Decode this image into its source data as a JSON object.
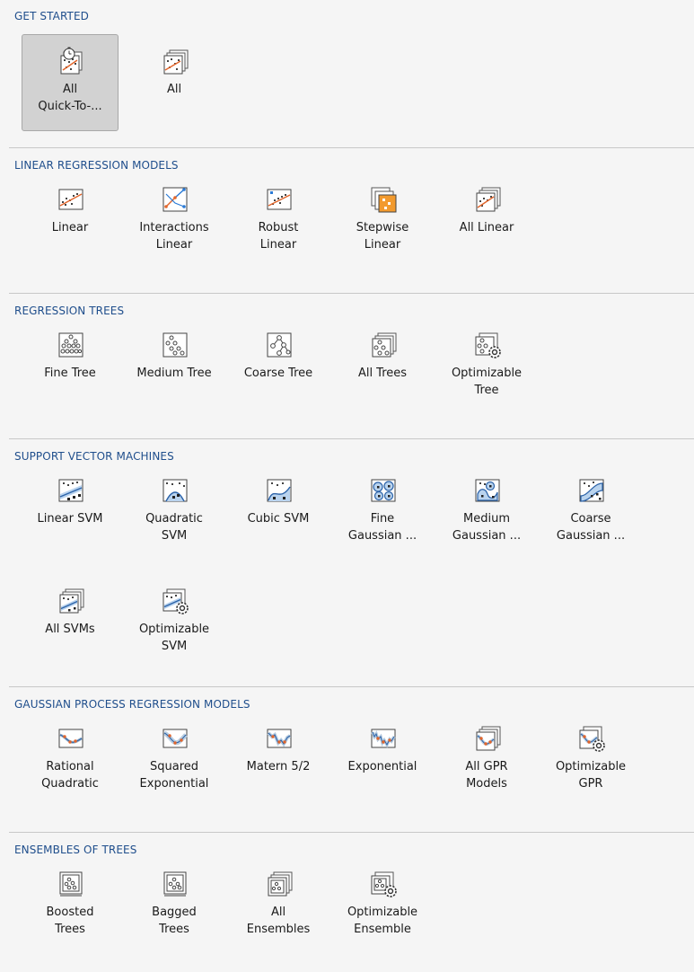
{
  "sections": {
    "get_started": {
      "title": "GET STARTED",
      "items": [
        {
          "label": "All\nQuick-To-...",
          "icon": "stopwatch-scatter-icon",
          "selected": true
        },
        {
          "label": "All",
          "icon": "stacked-scatter-icon"
        }
      ]
    },
    "linear": {
      "title": "LINEAR REGRESSION MODELS",
      "items": [
        {
          "label": "Linear",
          "icon": "linear-fit-icon"
        },
        {
          "label": "Interactions\nLinear",
          "icon": "interactions-linear-icon"
        },
        {
          "label": "Robust\nLinear",
          "icon": "robust-linear-icon"
        },
        {
          "label": "Stepwise\nLinear",
          "icon": "stepwise-linear-icon"
        },
        {
          "label": "All Linear",
          "icon": "stacked-linear-icon"
        }
      ]
    },
    "trees": {
      "title": "REGRESSION TREES",
      "items": [
        {
          "label": "Fine Tree",
          "icon": "fine-tree-icon"
        },
        {
          "label": "Medium Tree",
          "icon": "medium-tree-icon"
        },
        {
          "label": "Coarse Tree",
          "icon": "coarse-tree-icon"
        },
        {
          "label": "All Trees",
          "icon": "stacked-trees-icon"
        },
        {
          "label": "Optimizable\nTree",
          "icon": "optimizable-tree-icon"
        }
      ]
    },
    "svm": {
      "title": "SUPPORT VECTOR MACHINES",
      "items": [
        {
          "label": "Linear SVM",
          "icon": "linear-svm-icon"
        },
        {
          "label": "Quadratic\nSVM",
          "icon": "quadratic-svm-icon"
        },
        {
          "label": "Cubic SVM",
          "icon": "cubic-svm-icon"
        },
        {
          "label": "Fine\nGaussian ...",
          "icon": "fine-gaussian-svm-icon"
        },
        {
          "label": "Medium\nGaussian ...",
          "icon": "medium-gaussian-svm-icon"
        },
        {
          "label": "Coarse\nGaussian ...",
          "icon": "coarse-gaussian-svm-icon"
        },
        {
          "label": "All SVMs",
          "icon": "stacked-svm-icon"
        },
        {
          "label": "Optimizable\nSVM",
          "icon": "optimizable-svm-icon"
        }
      ]
    },
    "gpr": {
      "title": "GAUSSIAN PROCESS REGRESSION MODELS",
      "items": [
        {
          "label": "Rational\nQuadratic",
          "icon": "rational-quadratic-gpr-icon"
        },
        {
          "label": "Squared\nExponential",
          "icon": "squared-exponential-gpr-icon"
        },
        {
          "label": "Matern 5/2",
          "icon": "matern-gpr-icon"
        },
        {
          "label": "Exponential",
          "icon": "exponential-gpr-icon"
        },
        {
          "label": "All GPR\nModels",
          "icon": "stacked-gpr-icon"
        },
        {
          "label": "Optimizable\nGPR",
          "icon": "optimizable-gpr-icon"
        }
      ]
    },
    "ensembles": {
      "title": "ENSEMBLES OF TREES",
      "items": [
        {
          "label": "Boosted\nTrees",
          "icon": "boosted-trees-icon"
        },
        {
          "label": "Bagged\nTrees",
          "icon": "bagged-trees-icon"
        },
        {
          "label": "All\nEnsembles",
          "icon": "stacked-ensembles-icon"
        },
        {
          "label": "Optimizable\nEnsemble",
          "icon": "optimizable-ensemble-icon"
        }
      ]
    }
  }
}
